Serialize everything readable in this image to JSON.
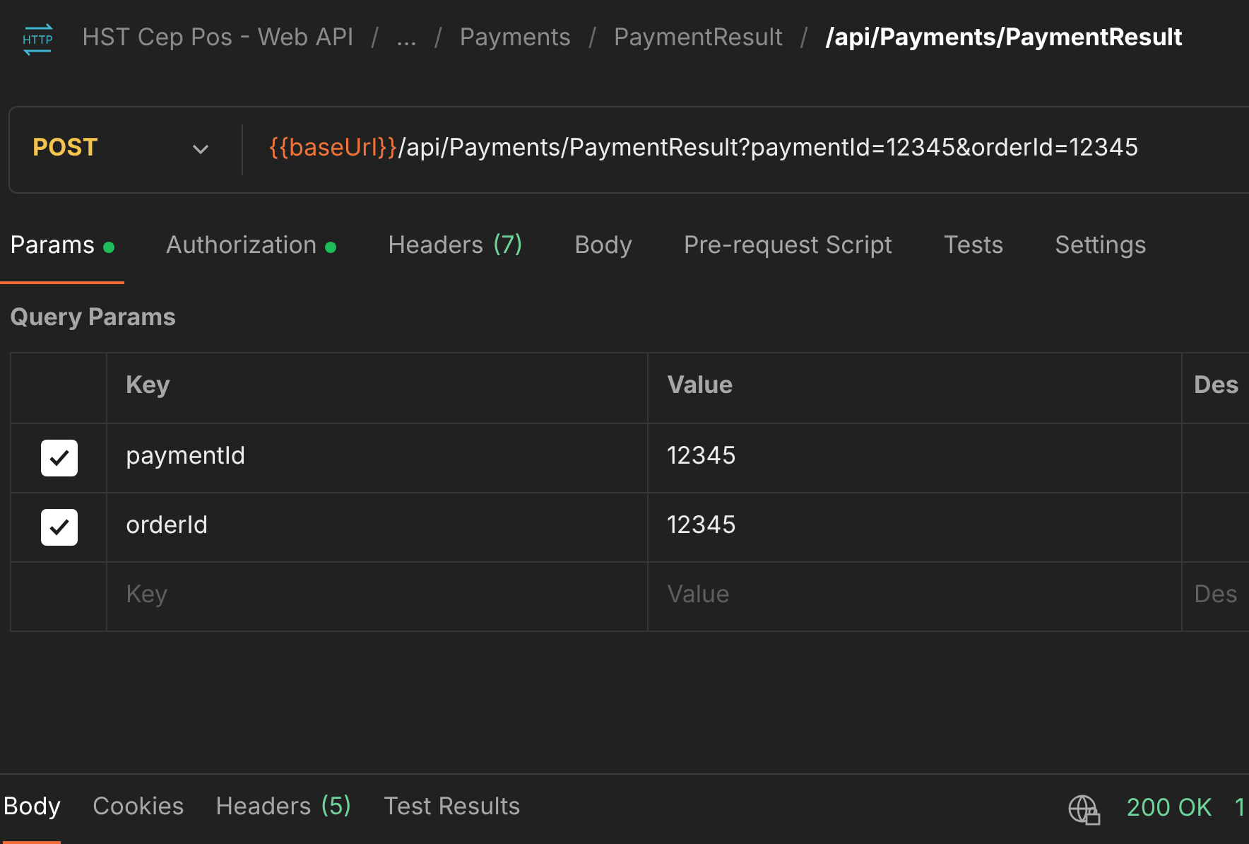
{
  "app_icon_label": "HTTP",
  "breadcrumb": {
    "items": [
      "HST Cep Pos - Web API",
      "...",
      "Payments",
      "PaymentResult"
    ],
    "separator": "/",
    "current": "/api/Payments/PaymentResult"
  },
  "request": {
    "method": "POST",
    "url_variable": "{{baseUrl}}",
    "url_rest": "/api/Payments/PaymentResult?paymentId=12345&orderId=12345"
  },
  "tabs": [
    {
      "label": "Params",
      "selected": true,
      "dot": true
    },
    {
      "label": "Authorization",
      "selected": false,
      "dot": true
    },
    {
      "label": "Headers",
      "count": "(7)",
      "selected": false,
      "dot": false
    },
    {
      "label": "Body",
      "selected": false,
      "dot": false
    },
    {
      "label": "Pre-request Script",
      "selected": false,
      "dot": false
    },
    {
      "label": "Tests",
      "selected": false,
      "dot": false
    },
    {
      "label": "Settings",
      "selected": false,
      "dot": false
    }
  ],
  "section_title": "Query Params",
  "table": {
    "columns": [
      "Key",
      "Value",
      "Des"
    ],
    "rows": [
      {
        "checked": true,
        "key": "paymentId",
        "value": "12345"
      },
      {
        "checked": true,
        "key": "orderId",
        "value": "12345"
      }
    ],
    "placeholders": [
      "Key",
      "Value",
      "Des"
    ]
  },
  "response_tabs": [
    {
      "label": "Body",
      "selected": true
    },
    {
      "label": "Cookies",
      "selected": false
    },
    {
      "label": "Headers",
      "count": "(5)",
      "selected": false
    },
    {
      "label": "Test Results",
      "selected": false
    }
  ],
  "status": {
    "code": "200 OK",
    "cut": "1"
  }
}
